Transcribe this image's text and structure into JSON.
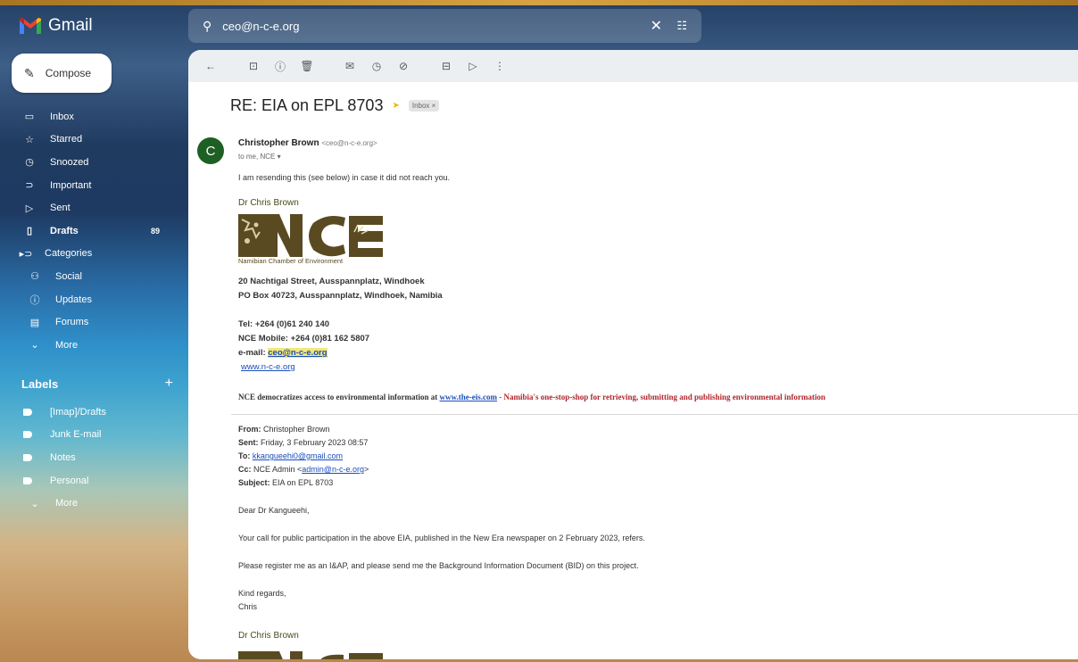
{
  "app": {
    "name": "Gmail"
  },
  "colors": {
    "accent_red": "#ea4335",
    "avatar_green": "#1e5f24",
    "link_blue": "#1a4ebd",
    "promo_red": "#b1252c"
  },
  "compose_label": "Compose",
  "nav": [
    {
      "label": "Inbox",
      "icon": "inbox-icon",
      "glyph": "▭"
    },
    {
      "label": "Starred",
      "icon": "star-icon",
      "glyph": "☆"
    },
    {
      "label": "Snoozed",
      "icon": "clock-icon",
      "glyph": "◷"
    },
    {
      "label": "Important",
      "icon": "important-icon",
      "glyph": "⊃"
    },
    {
      "label": "Sent",
      "icon": "send-icon",
      "glyph": "▷"
    },
    {
      "label": "Drafts",
      "icon": "draft-icon",
      "glyph": "▯",
      "count": "89"
    },
    {
      "label": "Categories",
      "icon": "label-icon",
      "glyph": "▸⊃"
    },
    {
      "label": "Social",
      "icon": "people-icon",
      "glyph": "⚇"
    },
    {
      "label": "Updates",
      "icon": "info-icon",
      "glyph": "ⓘ"
    },
    {
      "label": "Forums",
      "icon": "forum-icon",
      "glyph": "▤"
    },
    {
      "label": "More",
      "icon": "chevron-down-icon",
      "glyph": "⌄"
    }
  ],
  "labels_heading": "Labels",
  "labels_add": "+",
  "labels": [
    {
      "label": "[Imap]/Drafts"
    },
    {
      "label": "Junk E-mail"
    },
    {
      "label": "Notes"
    },
    {
      "label": "Personal"
    }
  ],
  "labels_more": "More",
  "search": {
    "value": "ceo@n-c-e.org"
  },
  "email": {
    "subject": "RE: EIA on EPL 8703",
    "chip": "Inbox ×",
    "avatar_letter": "C",
    "sender_name": "Christopher Brown",
    "sender_addr": "<ceo@n-c-e.org>",
    "to_line": "to me, NCE ▾",
    "intro": "I am resending this (see below) in case it did not reach you.",
    "sig_name": "Dr Chris Brown",
    "logo_text": "NCE",
    "logo_caption": "Namibian Chamber of Environment",
    "address1": "20 Nachtigal Street, Ausspannplatz, Windhoek",
    "address2": "PO Box 40723, Ausspannplatz,  Windhoek, Namibia",
    "tel": "Tel: +264 (0)61 240 140",
    "mobile": "NCE Mobile: +264 (0)81 162 5807",
    "email_label": "e-mail: ",
    "email_value": "ceo@n-c-e.org",
    "website": "www.n-c-e.org",
    "promo_prefix": "NCE democratizes access to environmental information at ",
    "promo_link": "www.the-eis.com",
    "promo_suffix": " - Namibia's one-stop-shop for retrieving, submitting and publishing environmental information",
    "from_label": "From:",
    "from_value": " Christopher Brown",
    "sent_label": "Sent:",
    "sent_value": " Friday, 3 February 2023 08:57",
    "to_label": "To:",
    "to_value": "kkangueehi0@gmail.com",
    "cc_label": "Cc:",
    "cc_prefix": " NCE Admin <",
    "cc_link": "admin@n-c-e.org",
    "cc_suffix": ">",
    "subj_label": "Subject:",
    "subj_value": " EIA on EPL 8703",
    "greeting": "Dear Dr Kangueehi,",
    "para1": "Your call for public participation in the above EIA, published in the New Era newspaper on 2 February 2023, refers.",
    "para2": "Please register me as an I&AP, and please send me the Background Information Document (BID)  on this project.",
    "regards": "Kind regards,",
    "signoff": "Chris",
    "sig_name2": "Dr Chris Brown"
  }
}
